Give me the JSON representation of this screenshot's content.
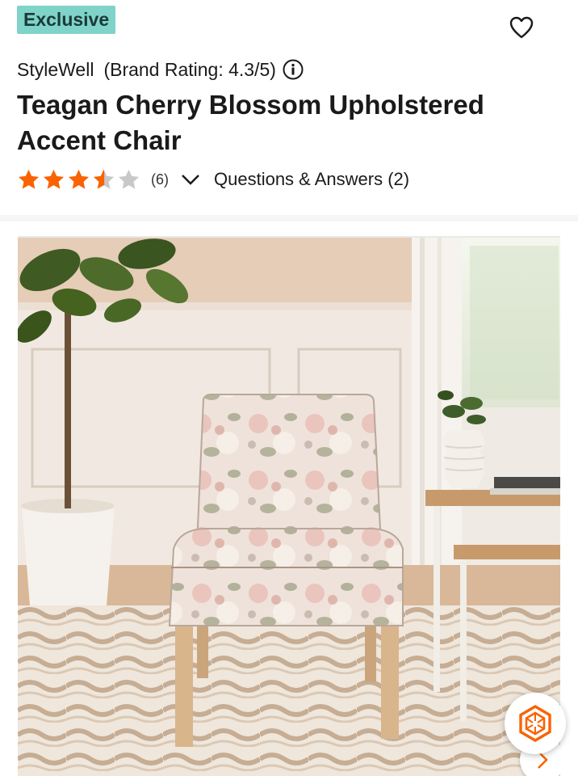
{
  "badge": {
    "label": "Exclusive",
    "color": "#7fd3c8"
  },
  "header": {
    "favorite_icon": "heart-icon"
  },
  "brand": {
    "name": "StyleWell",
    "rating_text": "(Brand Rating: 4.3/5)",
    "info_icon": "info-icon"
  },
  "product": {
    "title": "Teagan Cherry Blossom Upholstered Accent Chair"
  },
  "rating": {
    "stars_value": 3.5,
    "stars_max": 5,
    "star_color": "#f96302",
    "review_count": "(6)",
    "expand_icon": "chevron-down-icon",
    "qa_label": "Questions & Answers (2)"
  },
  "gallery": {
    "image_alt": "Floral upholstered accent chair in a living room",
    "next_icon": "chevron-right-icon",
    "accent_color": "#f96302"
  },
  "floating_action": {
    "icon": "hexagon-logo-icon"
  }
}
